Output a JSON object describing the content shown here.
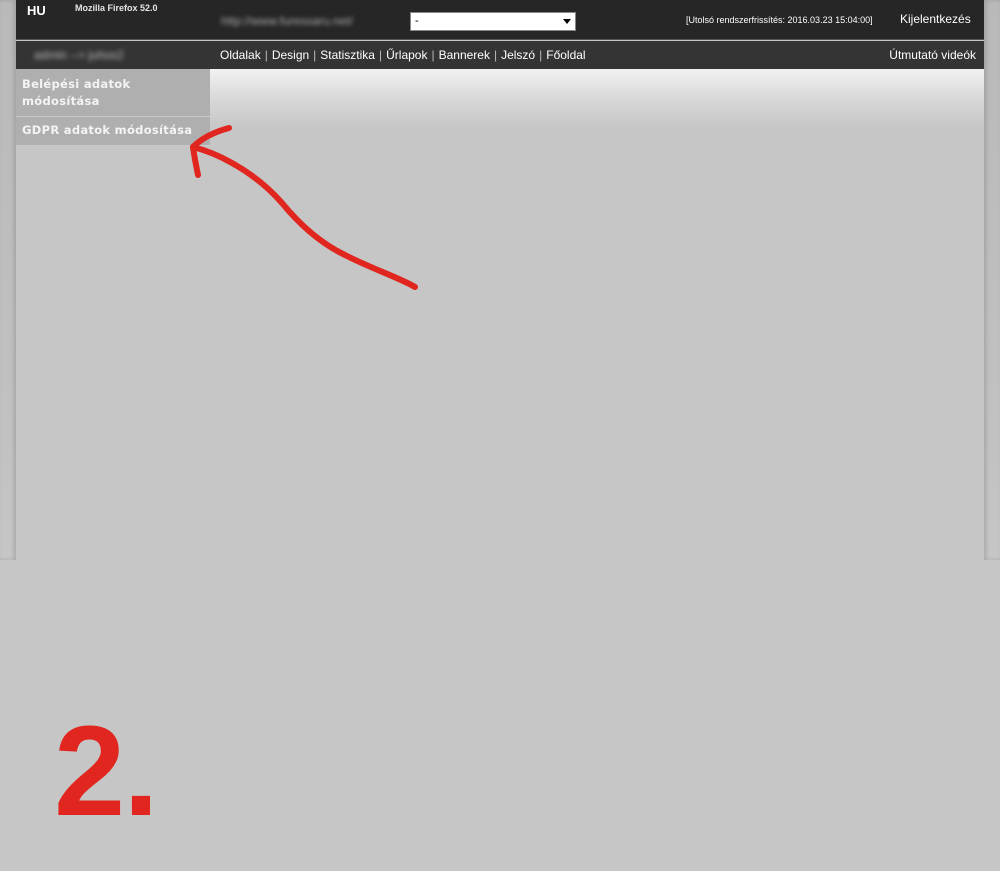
{
  "topbar": {
    "language": "HU",
    "browser": "Mozilla Firefox 52.0",
    "site_url": "http://www.furessaru.net/",
    "site_select_value": "-",
    "last_update": "[Utolsó rendszerfrissítés: 2016.03.23 15:04:00]",
    "logout": "Kijelentkezés"
  },
  "navbar": {
    "user_path": "admin --> juhos2",
    "menu": [
      "Oldalak",
      "Design",
      "Statisztika",
      "Űrlapok",
      "Bannerek",
      "Jelszó",
      "Főoldal"
    ],
    "separator": "|",
    "videos": "Útmutató videók"
  },
  "sidebar": {
    "items": [
      {
        "label": "Belépési adatok módosítása"
      },
      {
        "label": "GDPR adatok módosítása"
      }
    ]
  },
  "annotation": {
    "step_number": "2.",
    "color": "#e0261e"
  }
}
